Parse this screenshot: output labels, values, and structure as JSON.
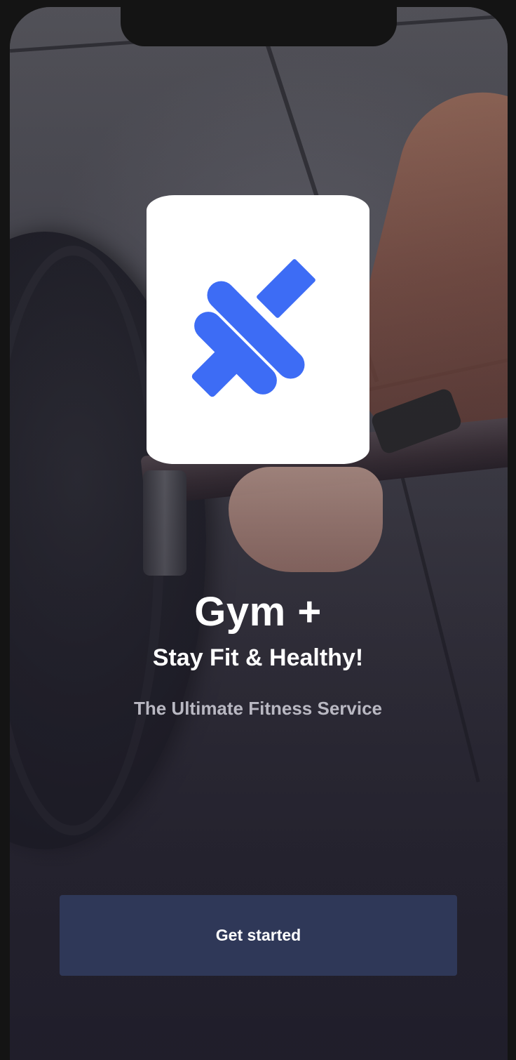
{
  "app": {
    "title": "Gym +",
    "subtitle": "Stay Fit & Healthy!",
    "tagline": "The Ultimate Fitness Service"
  },
  "logo": {
    "icon": "dumbbell-icon",
    "color": "#3d6cf5"
  },
  "actions": {
    "get_started_label": "Get started"
  },
  "colors": {
    "button_bg": "#2f3858",
    "button_text": "#ffffff",
    "title_text": "#ffffff",
    "tagline_text": "#b9b8c2"
  }
}
